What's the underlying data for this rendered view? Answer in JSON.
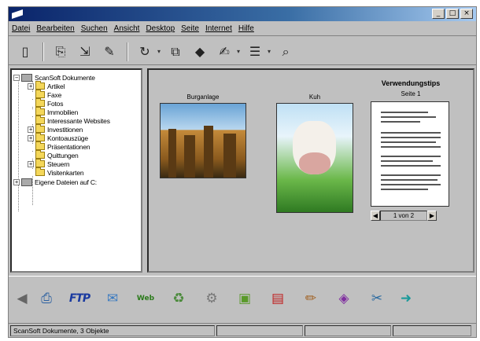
{
  "menubar": [
    "Datei",
    "Bearbeiten",
    "Suchen",
    "Ansicht",
    "Desktop",
    "Seite",
    "Internet",
    "Hilfe"
  ],
  "tree": {
    "root_label": "ScanSoft Dokumente",
    "items": [
      {
        "label": "Artikel",
        "expander": "+"
      },
      {
        "label": "Faxe",
        "expander": ""
      },
      {
        "label": "Fotos",
        "expander": ""
      },
      {
        "label": "Immobilien",
        "expander": ""
      },
      {
        "label": "Interessante Websites",
        "expander": ""
      },
      {
        "label": "Investitionen",
        "expander": "+"
      },
      {
        "label": "Kontoauszüge",
        "expander": "+"
      },
      {
        "label": "Präsentationen",
        "expander": ""
      },
      {
        "label": "Quittungen",
        "expander": ""
      },
      {
        "label": "Steuern",
        "expander": "+"
      },
      {
        "label": "Visitenkarten",
        "expander": ""
      }
    ],
    "second_root_label": "Eigene Dateien auf C:"
  },
  "content": {
    "thumb1_label": "Burganlage",
    "thumb2_label": "Kuh",
    "thumb3_title": "Verwendungstips",
    "thumb3_subtitle": "Seite 1",
    "pager_text": "1 von 2"
  },
  "statusbar": {
    "text": "ScanSoft Dokumente, 3 Objekte"
  },
  "icons": {
    "toolbar": [
      "new-document-icon",
      "scan-icon",
      "acquire-icon",
      "pencil-icon",
      "rotate-icon",
      "copy-icon",
      "eraser-icon",
      "stamp-icon",
      "list-view-icon",
      "zoom-icon"
    ],
    "bottom": [
      "back-arrow-icon",
      "printer-icon",
      "ftp-icon",
      "fax-icon",
      "web-icon",
      "recycle-icon",
      "tools-icon",
      "image-icon",
      "pdf-icon",
      "paint-icon",
      "color-icon",
      "scissors-icon",
      "forward-arrow-icon"
    ]
  },
  "colors": {
    "titlebar": "#0a246a",
    "window": "#c0c0c0"
  }
}
